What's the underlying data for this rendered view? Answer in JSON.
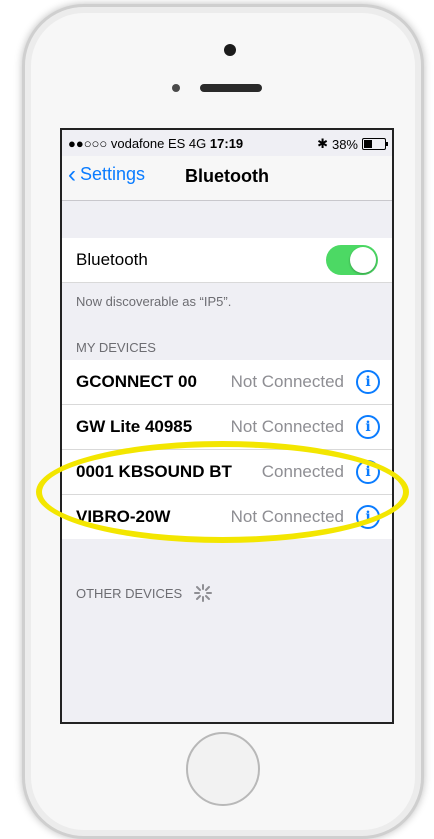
{
  "status_bar": {
    "carrier": "●●○○○ vodafone ES  4G",
    "time": "17:19",
    "bluetooth": "✱",
    "battery_percent": "38%"
  },
  "navbar": {
    "back_label": "Settings",
    "title": "Bluetooth"
  },
  "bluetooth_row": {
    "label": "Bluetooth",
    "enabled": true
  },
  "discoverable_text": "Now discoverable as “IP5”.",
  "my_devices_header": "MY DEVICES",
  "devices": [
    {
      "name": "GCONNECT 00",
      "status": "Not Connected"
    },
    {
      "name": "GW Lite 40985",
      "status": "Not Connected"
    },
    {
      "name": "0001 KBSOUND BT",
      "status": "Connected"
    },
    {
      "name": "VIBRO-20W",
      "status": "Not Connected"
    }
  ],
  "info_icon": "i",
  "other_devices_header": "OTHER DEVICES",
  "colors": {
    "accent": "#0a7cff",
    "toggle_on": "#4cd964",
    "highlight": "#f3e600"
  }
}
